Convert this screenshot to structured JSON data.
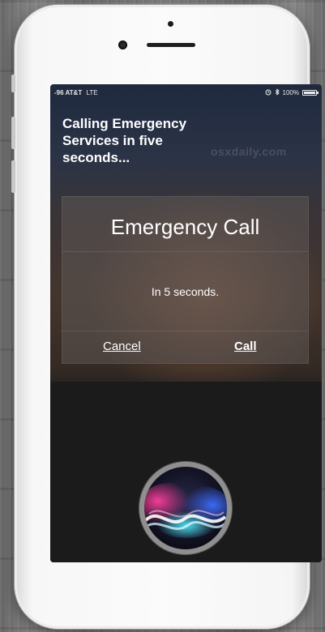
{
  "status_bar": {
    "carrier": "-96 AT&T",
    "network": "LTE",
    "battery_percent": "100%",
    "icons": [
      "alarm-icon",
      "bluetooth-icon",
      "battery-icon"
    ]
  },
  "siri": {
    "headline": "Calling Emergency\nServices in five\nseconds..."
  },
  "watermark": "osxdaily.com",
  "alert": {
    "title": "Emergency Call",
    "message": "In 5 seconds.",
    "cancel_label": "Cancel",
    "call_label": "Call"
  },
  "colors": {
    "text": "#ffffff",
    "screen_dark": "#1b1b1b",
    "phone_body": "#f7f7f7"
  }
}
